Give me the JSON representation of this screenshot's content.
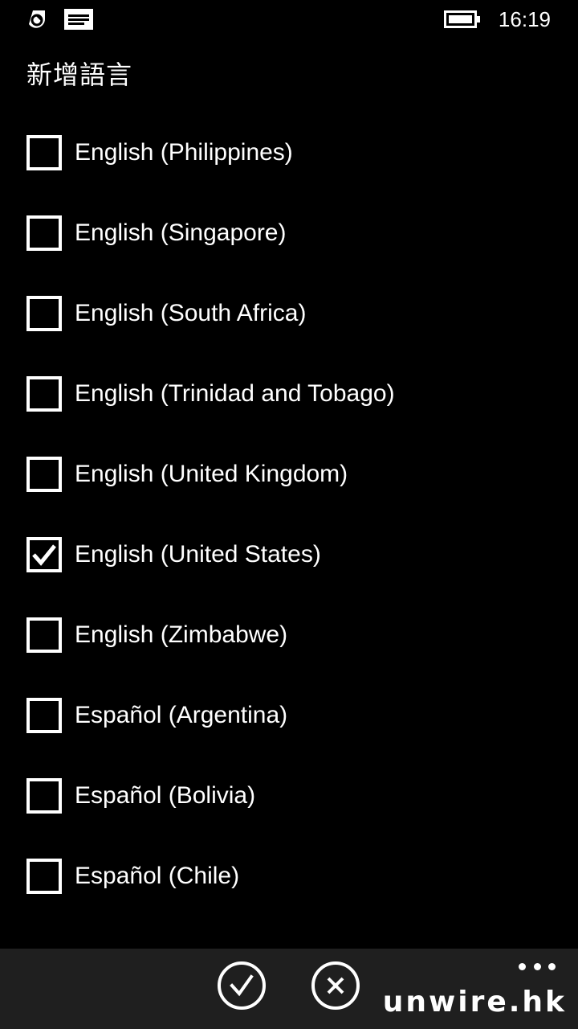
{
  "status_bar": {
    "time": "16:19",
    "icons": [
      "sync-icon",
      "message-icon",
      "battery-icon"
    ]
  },
  "page": {
    "title": "新增語言"
  },
  "languages": [
    {
      "label": "",
      "checked": false
    },
    {
      "label": "English (Philippines)",
      "checked": false
    },
    {
      "label": "English (Singapore)",
      "checked": false
    },
    {
      "label": "English (South Africa)",
      "checked": false
    },
    {
      "label": "English (Trinidad and Tobago)",
      "checked": false
    },
    {
      "label": "English (United Kingdom)",
      "checked": false
    },
    {
      "label": "English (United States)",
      "checked": true
    },
    {
      "label": "English (Zimbabwe)",
      "checked": false
    },
    {
      "label": "Español (Argentina)",
      "checked": false
    },
    {
      "label": "Español (Bolivia)",
      "checked": false
    },
    {
      "label": "Español (Chile)",
      "checked": false
    }
  ],
  "app_bar": {
    "buttons": [
      "check-icon",
      "cancel-icon",
      "more-icon"
    ]
  },
  "watermark": "unwire.hk"
}
